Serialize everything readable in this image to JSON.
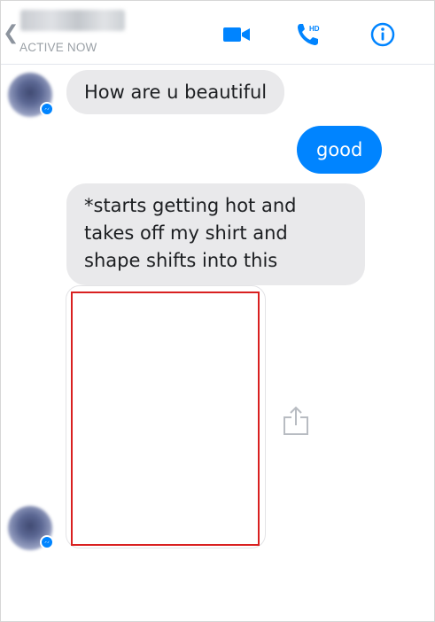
{
  "header": {
    "back_icon": "chevron-left-icon",
    "status": "ACTIVE NOW",
    "icons": [
      "video-camera-icon",
      "hd-phone-icon",
      "info-icon"
    ],
    "accent_color": "#0084ff"
  },
  "messages": [
    {
      "sender": "contact",
      "text": "How are u beautiful"
    },
    {
      "sender": "me",
      "text": "good"
    },
    {
      "sender": "contact",
      "text": "*starts getting hot and takes off my shirt and shape shifts into this"
    }
  ],
  "attachment": {
    "type": "image",
    "redaction_color": "#d92020",
    "share_icon": "share-icon"
  },
  "colors": {
    "incoming_bubble": "#e9e9eb",
    "outgoing_bubble": "#0084ff"
  }
}
